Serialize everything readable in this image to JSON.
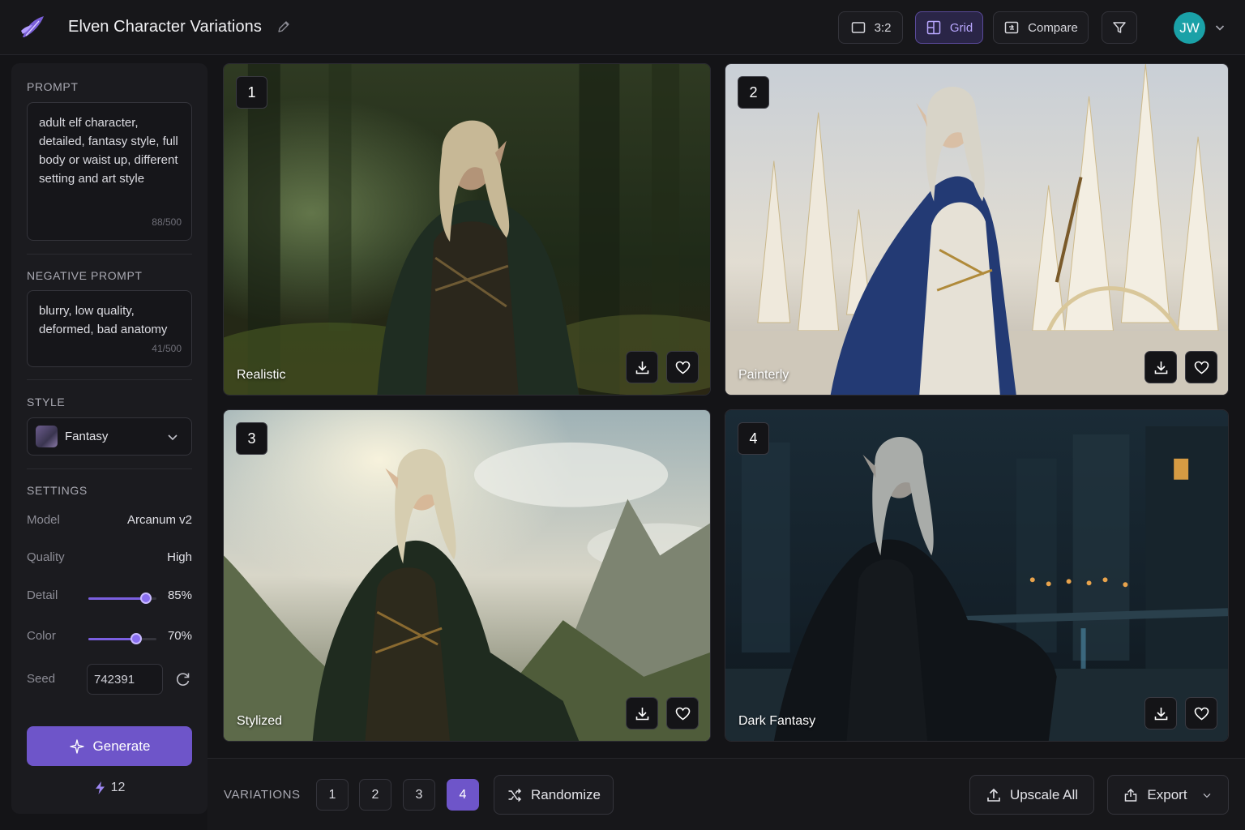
{
  "app": {
    "title": "Elven Character Variations"
  },
  "header": {
    "aspect_label": "3:2",
    "grid_label": "Grid",
    "compare_label": "Compare",
    "avatar_initials": "JW"
  },
  "sidebar": {
    "prompt": {
      "label": "PROMPT",
      "value": "adult elf character, detailed, fantasy style, full body or waist up, different setting and art style",
      "counter": "88/500"
    },
    "negative_prompt": {
      "label": "NEGATIVE PROMPT",
      "value": "blurry, low quality, deformed, bad anatomy",
      "counter": "41/500"
    },
    "style": {
      "label": "STYLE",
      "value": "Fantasy"
    },
    "settings": {
      "label": "SETTINGS",
      "model_label": "Model",
      "model_value": "Arcanum v2",
      "quality_label": "Quality",
      "quality_value": "High",
      "detail_label": "Detail",
      "detail_value": "85%",
      "detail_fraction": 0.85,
      "color_label": "Color",
      "color_value": "70%",
      "color_fraction": 0.7,
      "seed_label": "Seed",
      "seed_value": "742391"
    },
    "generate_label": "Generate",
    "credits": "12"
  },
  "images": [
    {
      "number": "1",
      "caption": "Realistic"
    },
    {
      "number": "2",
      "caption": "Painterly"
    },
    {
      "number": "3",
      "caption": "Stylized"
    },
    {
      "number": "4",
      "caption": "Dark Fantasy"
    }
  ],
  "bottom": {
    "variations_label": "VARIATIONS",
    "variation_buttons": [
      "1",
      "2",
      "3",
      "4"
    ],
    "active_variation": "4",
    "randomize_label": "Randomize",
    "upscale_label": "Upscale All",
    "export_label": "Export"
  },
  "colors": {
    "accent": "#6e55c9",
    "background": "#141417",
    "avatar": "#1aa1a7"
  }
}
